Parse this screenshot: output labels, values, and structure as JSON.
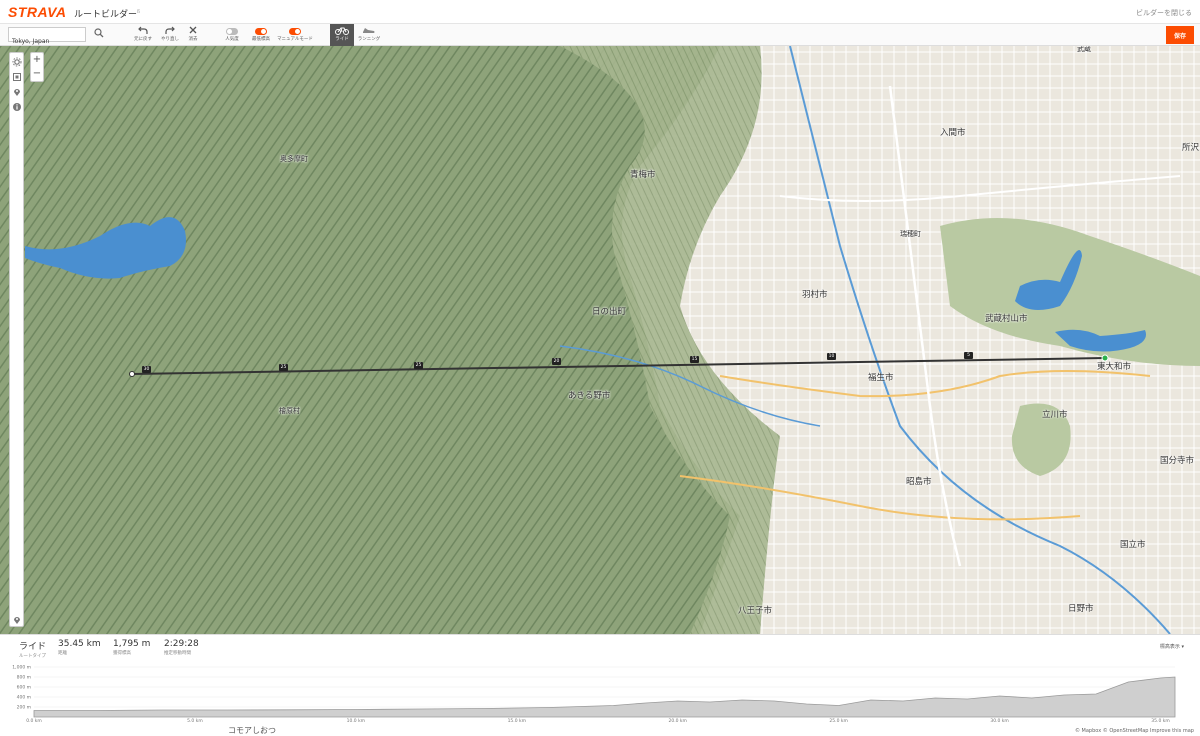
{
  "app": {
    "logo": "STRAVA",
    "title": "ルートビルダー",
    "beta": "ß",
    "exit": "ビルダーを閉じる"
  },
  "search": {
    "value": "Tokyo, Japan",
    "placeholder": ""
  },
  "tools": [
    {
      "name": "undo",
      "label": "元に戻す"
    },
    {
      "name": "redo",
      "label": "やり直し"
    },
    {
      "name": "clear",
      "label": "消去"
    }
  ],
  "toggles": [
    {
      "name": "popularity",
      "label": "人気度",
      "on": false
    },
    {
      "name": "min-elevation",
      "label": "最低標高",
      "on": true
    },
    {
      "name": "manual-mode",
      "label": "マニュアルモード",
      "on": true
    }
  ],
  "sports": [
    {
      "name": "ride",
      "label": "ライド",
      "active": true
    },
    {
      "name": "run",
      "label": "ランニング",
      "active": false
    }
  ],
  "save_label": "保存",
  "map": {
    "places": [
      {
        "name": "iruma",
        "text": "入間市",
        "cls": ""
      },
      {
        "name": "tokorozawa",
        "text": "所沢",
        "cls": ""
      },
      {
        "name": "okutama",
        "text": "奥多摩町",
        "cls": "small"
      },
      {
        "name": "ome",
        "text": "青梅市",
        "cls": ""
      },
      {
        "name": "mizuho",
        "text": "瑞穂町",
        "cls": "small"
      },
      {
        "name": "hamura",
        "text": "羽村市",
        "cls": ""
      },
      {
        "name": "hinode",
        "text": "日の出町",
        "cls": ""
      },
      {
        "name": "musashimurayama",
        "text": "武蔵村山市",
        "cls": ""
      },
      {
        "name": "higashiyamato",
        "text": "東大和市",
        "cls": ""
      },
      {
        "name": "fussa",
        "text": "福生市",
        "cls": ""
      },
      {
        "name": "akiruno",
        "text": "あきる野市",
        "cls": ""
      },
      {
        "name": "hinohara",
        "text": "檜原村",
        "cls": "small"
      },
      {
        "name": "tachikawa",
        "text": "立川市",
        "cls": ""
      },
      {
        "name": "kokubunji",
        "text": "国分寺市",
        "cls": ""
      },
      {
        "name": "akishima",
        "text": "昭島市",
        "cls": ""
      },
      {
        "name": "kunitachi",
        "text": "国立市",
        "cls": ""
      },
      {
        "name": "hachioji",
        "text": "八王子市",
        "cls": ""
      },
      {
        "name": "hino",
        "text": "日野市",
        "cls": ""
      },
      {
        "name": "fujisawa",
        "text": "武蔵",
        "cls": "small"
      }
    ],
    "route_markers": [
      "30",
      "25",
      "25",
      "20",
      "15",
      "10",
      "5"
    ]
  },
  "stats": {
    "type": {
      "value": "ライド",
      "label": "ルートタイプ"
    },
    "distance": {
      "value": "35.45 km",
      "label": "距離"
    },
    "elevation": {
      "value": "1,795 m",
      "label": "獲得標高"
    },
    "time": {
      "value": "2:29:28",
      "label": "推定移動時間"
    },
    "elev_mode": "標高表示"
  },
  "elevation_chart": {
    "y_ticks": [
      "1,000 m",
      "800 m",
      "600 m",
      "400 m",
      "200 m"
    ],
    "x_ticks": [
      "0.0 km",
      "5.0 km",
      "10.0 km",
      "15.0 km",
      "20.0 km",
      "25.0 km",
      "30.0 km",
      "35.0 km"
    ],
    "profile_km": [
      0,
      2,
      4,
      6,
      8,
      10,
      12,
      14,
      16,
      18,
      19,
      20,
      21,
      22,
      23,
      24,
      25,
      26,
      27,
      28,
      29,
      30,
      31,
      32,
      33,
      34,
      35,
      35.45
    ],
    "profile_m": [
      130,
      130,
      140,
      140,
      145,
      150,
      160,
      170,
      190,
      230,
      280,
      320,
      300,
      340,
      320,
      260,
      230,
      340,
      320,
      380,
      360,
      420,
      380,
      440,
      460,
      700,
      780,
      800
    ]
  },
  "attribution": "© Mapbox © OpenStreetMap Improve this map",
  "map_bottom": "コモアしおつ"
}
